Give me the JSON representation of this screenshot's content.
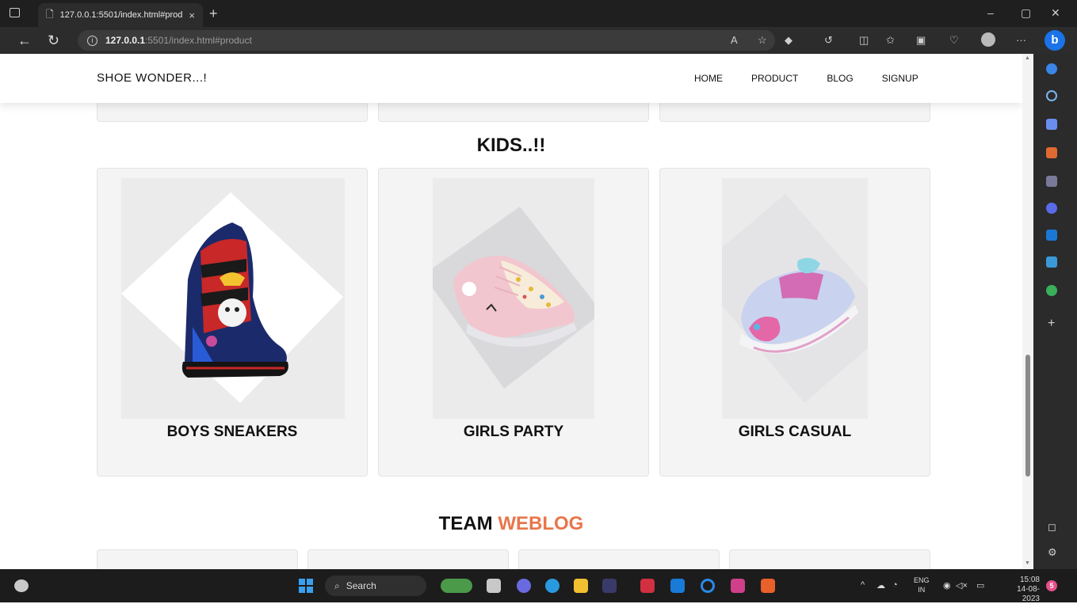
{
  "browser": {
    "tab_title": "127.0.0.1:5501/index.html#produ",
    "tab_close": "×",
    "new_tab": "+",
    "url_host": "127.0.0.1",
    "url_rest": ":5501/index.html#product",
    "window_controls": [
      "–",
      "▢",
      "✕"
    ],
    "bing_label": "b"
  },
  "site": {
    "brand": "SHOE WONDER...!",
    "nav": [
      "HOME",
      "PRODUCT",
      "BLOG",
      "SIGNUP"
    ]
  },
  "kids": {
    "title": "KIDS..!!",
    "cards": [
      {
        "title": "BOYS SNEAKERS",
        "image": "boys-sneaker-icon"
      },
      {
        "title": "GIRLS PARTY",
        "image": "girls-party-shoe-icon"
      },
      {
        "title": "GIRLS CASUAL",
        "image": "girls-casual-shoe-icon"
      }
    ]
  },
  "team": {
    "title_main": "TEAM",
    "title_accent": "WEBLOG",
    "accent_color": "#e8764a"
  },
  "taskbar": {
    "search_label": "Search",
    "lang_top": "ENG",
    "lang_bottom": "IN",
    "time": "15:08",
    "date": "14-08-2023",
    "notification_count": "5"
  }
}
